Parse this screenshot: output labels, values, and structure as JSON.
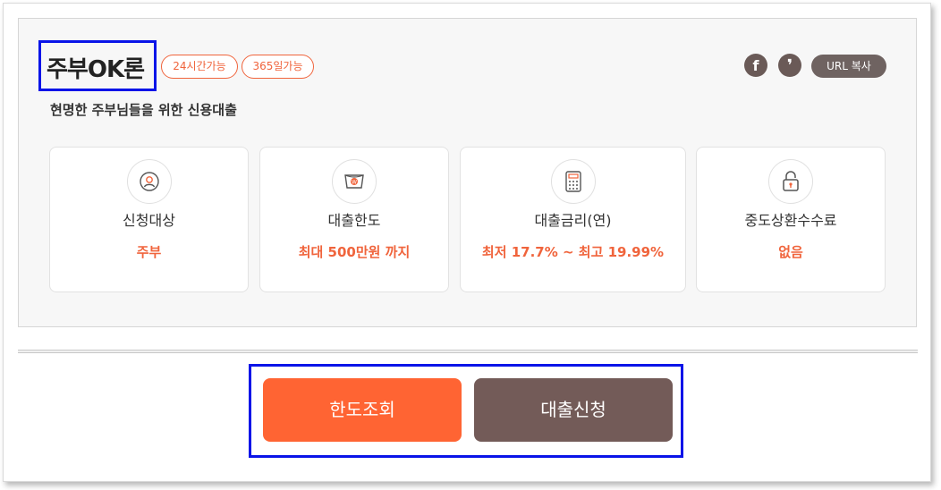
{
  "product": {
    "title": "주부OK론",
    "tags": [
      "24시간가능",
      "365일가능"
    ],
    "subtitle": "현명한 주부님들을 위한 신용대출"
  },
  "share": {
    "facebook_glyph": "f",
    "kakao_glyph": "❜",
    "url_copy_label": "URL 복사"
  },
  "cards": [
    {
      "label": "신청대상",
      "value": "주부",
      "icon": "user-icon"
    },
    {
      "label": "대출한도",
      "value": "최대 500만원 까지",
      "icon": "money-icon"
    },
    {
      "label": "대출금리(연)",
      "value": "최저 17.7% ~ 최고 19.99%",
      "icon": "calculator-icon"
    },
    {
      "label": "중도상환수수료",
      "value": "없음",
      "icon": "lock-icon"
    }
  ],
  "actions": {
    "limit_check_label": "한도조회",
    "apply_label": "대출신청"
  },
  "colors": {
    "accent": "#ff6433",
    "tag_orange": "#f0643c",
    "brown": "#735b58",
    "annotation_blue": "#0a14e8"
  }
}
